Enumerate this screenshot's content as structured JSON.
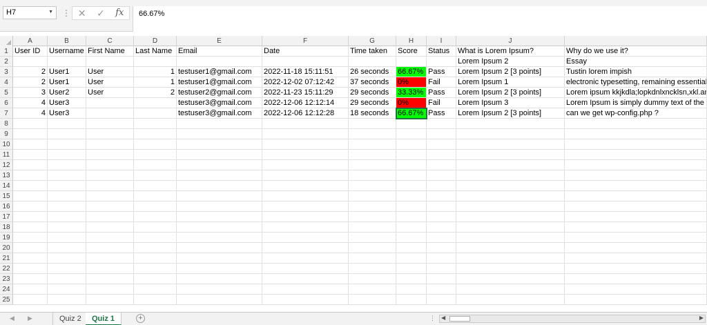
{
  "formula_bar": {
    "name_box": "H7",
    "formula": "66.67%",
    "cancel_icon": "✕",
    "enter_icon": "✓",
    "fx_label": "fx"
  },
  "columns": [
    "A",
    "B",
    "C",
    "D",
    "E",
    "F",
    "G",
    "H",
    "I",
    "J"
  ],
  "row_numbers": [
    "1",
    "2",
    "3",
    "4",
    "5",
    "6",
    "7",
    "8",
    "9",
    "10",
    "11",
    "12",
    "13",
    "14",
    "15",
    "16",
    "17",
    "18",
    "19",
    "20",
    "21",
    "22",
    "23",
    "24",
    "25"
  ],
  "headers": [
    "User ID",
    "Username",
    "First Name",
    "Last Name",
    "Email",
    "Date",
    "Time taken",
    "Score",
    "Status",
    "What is Lorem Ipsum?",
    "Why do we use it?"
  ],
  "row2": {
    "j": "Lorem Ipsum 2",
    "k": "Essay"
  },
  "rows": [
    {
      "user_id": "2",
      "username": "User1",
      "first_name": "User",
      "last_name": "1",
      "email": "testuser1@gmail.com",
      "date": "2022-11-18 15:11:51",
      "time_taken": "26 seconds",
      "score": "66.67%",
      "status": "Pass",
      "q1": "Lorem Ipsum 2 [3 points]",
      "q2": "Tustin lorem impish"
    },
    {
      "user_id": "2",
      "username": "User1",
      "first_name": "User",
      "last_name": "1",
      "email": "testuser1@gmail.com",
      "date": "2022-12-02 07:12:42",
      "time_taken": "37 seconds",
      "score": "0%",
      "status": "Fail",
      "q1": "Lorem Ipsum 1",
      "q2": "electronic typesetting, remaining essentiall"
    },
    {
      "user_id": "3",
      "username": "User2",
      "first_name": "User",
      "last_name": "2",
      "email": "testuser2@gmail.com",
      "date": "2022-11-23 15:11:29",
      "time_taken": "29 seconds",
      "score": "33.33%",
      "status": "Pass",
      "q1": "Lorem Ipsum 2 [3 points]",
      "q2": "Lorem ipsum kkjkdla;lopkdnlxncklsn,xkl.anl"
    },
    {
      "user_id": "4",
      "username": "User3",
      "first_name": "",
      "last_name": "",
      "email": "testuser3@gmail.com",
      "date": "2022-12-06 12:12:14",
      "time_taken": "29 seconds",
      "score": "0%",
      "status": "Fail",
      "q1": "Lorem Ipsum 3",
      "q2": "Lorem Ipsum is simply dummy text of the p"
    },
    {
      "user_id": "4",
      "username": "User3",
      "first_name": "",
      "last_name": "",
      "email": "testuser3@gmail.com",
      "date": "2022-12-06 12:12:28",
      "time_taken": "18 seconds",
      "score": "66.67%",
      "status": "Pass",
      "q1": "Lorem Ipsum 2 [3 points]",
      "q2": "can we get wp-config.php ?"
    }
  ],
  "score_colors": {
    "pass": "#00ff00",
    "fail": "#ff0000"
  },
  "sheets": [
    {
      "label": "Quiz 2",
      "active": false
    },
    {
      "label": "Quiz 1",
      "active": true
    }
  ],
  "icons": {
    "add_sheet": "plus-circle-icon",
    "nav_prev": "triangle-left-icon",
    "nav_next": "triangle-right-icon"
  }
}
